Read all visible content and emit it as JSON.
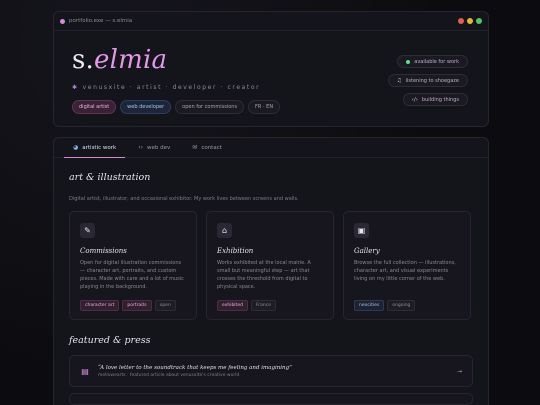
{
  "window": {
    "title": "portfolio.exe — s.elmia",
    "lights": [
      "#e0614f",
      "#e6b43a",
      "#55c65b"
    ]
  },
  "hero": {
    "name_prefix": "s.",
    "name_accent": "elmia",
    "tagline": "venusxite · artist · developer · creator",
    "chips": [
      "digital artist",
      "web developer",
      "open for commissions",
      "FR · EN"
    ]
  },
  "status": {
    "available": "available for work",
    "listening": "listening to shoegaze",
    "building": "building things"
  },
  "tabs": [
    {
      "label": "artistic work"
    },
    {
      "label": "web dev"
    },
    {
      "label": "contact"
    }
  ],
  "art": {
    "title": "art & illustration",
    "description": "Digital artist, illustrator, and occasional exhibitor. My work lives between screens and walls."
  },
  "cards": [
    {
      "title": "Commissions",
      "body": "Open for digital illustration commissions — character art, portraits, and custom pieces. Made with care and a lot of music playing in the background.",
      "tags": [
        "character art",
        "portraits",
        "open"
      ]
    },
    {
      "title": "Exhibition",
      "body": "Works exhibited at the local mairie. A small but meaningful step — art that crosses the threshold from digital to physical space.",
      "tags": [
        "exhibited",
        "France"
      ]
    },
    {
      "title": "Gallery",
      "body": "Browse the full collection — illustrations, character art, and visual experiments living on my little corner of the web.",
      "tags": [
        "neocities",
        "ongoing"
      ]
    }
  ],
  "featured": {
    "title": "featured & press",
    "items": [
      {
        "quote": "“A love letter to the soundtrack that keeps me feeling and imagining”",
        "source": "mellowearts · featured article about venusxite's creative world",
        "arrow": "→"
      }
    ]
  }
}
